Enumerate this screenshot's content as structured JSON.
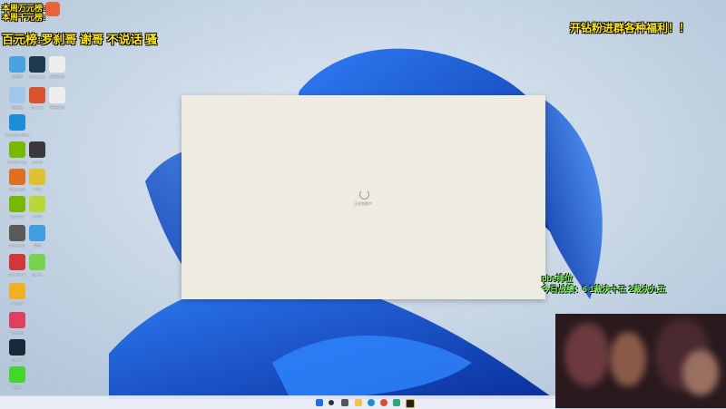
{
  "overlay": {
    "weekly_rank_1": "本周万元榜:",
    "weekly_rank_2": "本周千元榜:",
    "hundred_rank": "百元榜:",
    "hundred_rank_names": "罗刹哥 谢哥 不说话 骚",
    "promo": "开钻粉进群各种福利！！",
    "stats_title": "pbe排位",
    "stats_line": "今日战绩：6 1裁决十五 2裁决九五"
  },
  "desktop_icons": [
    {
      "label": "此电脑",
      "color": "#4aa3df"
    },
    {
      "label": "Dashcast",
      "color": "#1f3a4d"
    },
    {
      "label": "新建文本",
      "color": "#eeeeee"
    },
    {
      "label": "回收站",
      "color": "#9fc7e8"
    },
    {
      "label": "Scratch",
      "color": "#d9532c"
    },
    {
      "label": "新建文本",
      "color": "#eeeeee"
    },
    {
      "label": "Microsoft Edge",
      "color": "#1a8fd8"
    },
    {
      "label": "NVIDIA App",
      "color": "#76b900"
    },
    {
      "label": "Dota2",
      "color": "#3a3a3a"
    },
    {
      "label": "Wallpaper",
      "color": "#e07020"
    },
    {
      "label": "Unity",
      "color": "#dfc232"
    },
    {
      "label": "GeForce",
      "color": "#76b900"
    },
    {
      "label": "UPUP",
      "color": "#b8d83a"
    },
    {
      "label": "Recovery",
      "color": "#5a5a5a"
    },
    {
      "label": "设置",
      "color": "#3fa0e0"
    },
    {
      "label": "Riot Client",
      "color": "#d13639"
    },
    {
      "label": "Steam",
      "color": "#79d34e"
    },
    {
      "label": "Firelight",
      "color": "#f0b020"
    },
    {
      "label": "Record",
      "color": "#e04060"
    },
    {
      "label": "Steam",
      "color": "#1b2838"
    },
    {
      "label": "Razer",
      "color": "#44d62c"
    }
  ],
  "window": {
    "loading_text": "正在加载中"
  },
  "taskbar": {
    "icons": [
      "start-icon",
      "search-icon",
      "taskview-icon",
      "explorer-icon",
      "edge-icon",
      "chrome-icon",
      "app-icon",
      "game-icon"
    ]
  }
}
